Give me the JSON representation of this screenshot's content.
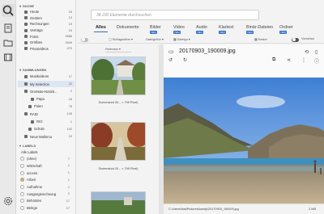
{
  "sidebar": {
    "search_heading": "SUCHE",
    "search_items": [
      {
        "label": "Heute",
        "count": "15"
      },
      {
        "label": "Gestern",
        "count": "13"
      },
      {
        "label": "Rechnungen",
        "count": "19"
      },
      {
        "label": "Verträge",
        "count": "24"
      },
      {
        "label": "Fotos",
        "count": "4668"
      },
      {
        "label": "Größten",
        "count": "3549"
      },
      {
        "label": "Privatvideos",
        "count": "479"
      }
    ],
    "collections_heading": "SAMMLUNGEN",
    "collection_items": [
      {
        "label": "Musikvideos",
        "count": "17"
      },
      {
        "label": "My Selection",
        "count": "22"
      },
      {
        "label": "OneNote-Notizb...",
        "count": "2"
      },
      {
        "label": "Papa",
        "count": "18"
      },
      {
        "label": "Polen",
        "count": "78"
      },
      {
        "label": "RAID",
        "count": "145"
      },
      {
        "label": "RIO",
        "count": "1"
      },
      {
        "label": "Schule",
        "count": "102"
      },
      {
        "label": "Neue Mallorca",
        "count": "19"
      }
    ],
    "labels_heading": "LABELS",
    "all_labels": "Alle Labels",
    "label_items": [
      {
        "label": "(ohne)",
        "count": "7",
        "color": "#ffffff"
      },
      {
        "label": "Wirtschaft",
        "count": "1",
        "color": "#ffffff"
      },
      {
        "label": "access",
        "count": "1",
        "color": "#ffffff"
      },
      {
        "label": "Arbeit",
        "count": "1",
        "color": "#f2a33a"
      },
      {
        "label": "Aufnahme",
        "count": "1",
        "color": "#ffffff"
      },
      {
        "label": "Ausgangsrechnung",
        "count": "2",
        "color": "#ffffff"
      },
      {
        "label": "Behörden",
        "count": "17",
        "color": "#ffffff"
      },
      {
        "label": "Belege",
        "count": "17",
        "color": "#ffffff"
      }
    ]
  },
  "search": {
    "placeholder": "38.230 Elemente durchsuchen"
  },
  "tabs": [
    {
      "label": "Alles",
      "new": ""
    },
    {
      "label": "Dokumente",
      "new": ""
    },
    {
      "label": "Bilder",
      "new": "NEU"
    },
    {
      "label": "Video",
      "new": "NEU"
    },
    {
      "label": "Audio",
      "new": "NEU"
    },
    {
      "label": "Klartext",
      "new": "NEU"
    },
    {
      "label": "Binär-Dateien",
      "new": "NEU"
    },
    {
      "label": "Ordner",
      "new": "NEU"
    }
  ],
  "filters": {
    "keywords": "Schlagwörter",
    "filesize": "Dateigröße",
    "date": "Datetyp",
    "raster": "Raster",
    "preview": "Vorschau"
  },
  "results": {
    "sort": "Relevanz",
    "captions": [
      "Screenshot 20... × 799 Pixel)",
      "Screenshot 20... × 799 Pixel)"
    ]
  },
  "preview": {
    "filename": "20170903_190009.jpg",
    "path": "C:\\Users\\Isst\\Pictures\\bandy\\20170903_190009.jpg",
    "size": "2 MB"
  }
}
